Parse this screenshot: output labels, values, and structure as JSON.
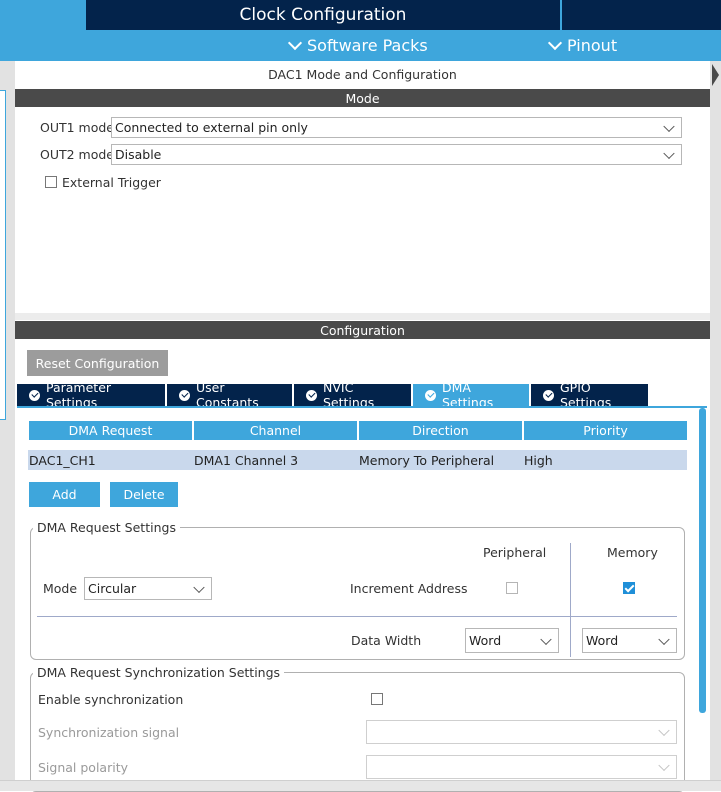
{
  "header": {
    "title": "Clock Configuration",
    "software_packs": "Software Packs",
    "pinout": "Pinout"
  },
  "panel_title": "DAC1 Mode and Configuration",
  "mode": {
    "section_title": "Mode",
    "out1_label": "OUT1 mode",
    "out1_value": "Connected to external pin only",
    "out2_label": "OUT2 mode",
    "out2_value": "Disable",
    "external_trigger_label": "External Trigger",
    "external_trigger_checked": false
  },
  "configuration": {
    "section_title": "Configuration",
    "reset_button": "Reset Configuration",
    "tabs": [
      {
        "label": "Parameter Settings",
        "active": false
      },
      {
        "label": "User Constants",
        "active": false
      },
      {
        "label": "NVIC Settings",
        "active": false
      },
      {
        "label": "DMA Settings",
        "active": true
      },
      {
        "label": "GPIO Settings",
        "active": false
      }
    ]
  },
  "dma_table": {
    "headers": [
      "DMA Request",
      "Channel",
      "Direction",
      "Priority"
    ],
    "rows": [
      [
        "DAC1_CH1",
        "DMA1 Channel 3",
        "Memory To Peripheral",
        "High"
      ]
    ],
    "add_button": "Add",
    "delete_button": "Delete"
  },
  "dma_request_settings": {
    "legend": "DMA Request Settings",
    "peripheral_header": "Peripheral",
    "memory_header": "Memory",
    "mode_label": "Mode",
    "mode_value": "Circular",
    "increment_label": "Increment Address",
    "peripheral_increment": false,
    "memory_increment": true,
    "data_width_label": "Data Width",
    "peripheral_width": "Word",
    "memory_width": "Word"
  },
  "sync_settings": {
    "legend": "DMA Request Synchronization Settings",
    "enable_label": "Enable synchronization",
    "enable_checked": false,
    "signal_label": "Synchronization signal",
    "signal_value": "",
    "polarity_label": "Signal polarity",
    "polarity_value": ""
  },
  "colors": {
    "accent": "#3ea6dc",
    "navy": "#03234b",
    "section_bar": "#4a4a4a",
    "row_selected": "#c9d8ec"
  }
}
